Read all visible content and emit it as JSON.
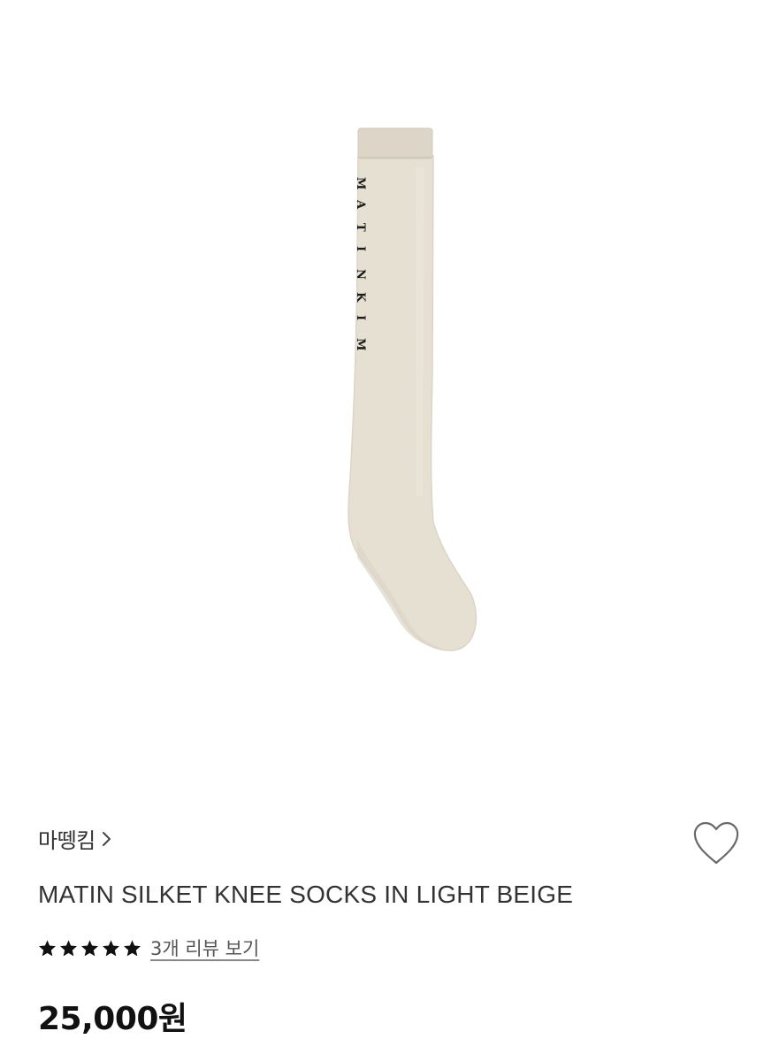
{
  "product_image": {
    "icon": "knee-sock-image",
    "sock_color": "#e6e0d3",
    "cuff_color": "#ddd5c8",
    "print_letters": [
      "M",
      "A",
      "T",
      "I",
      "N",
      "K",
      "I",
      "M"
    ]
  },
  "brand": {
    "name": "마뗑킴",
    "chevron_icon": "chevron-right-icon"
  },
  "wishlist": {
    "icon": "heart-outline-icon"
  },
  "product": {
    "title": "MATIN SILKET KNEE SOCKS IN LIGHT BEIGE"
  },
  "rating": {
    "stars": 5,
    "max_stars": 5,
    "star_icon": "star-icon",
    "review_link": "3개 리뷰 보기"
  },
  "price": {
    "text": "25,000원"
  }
}
